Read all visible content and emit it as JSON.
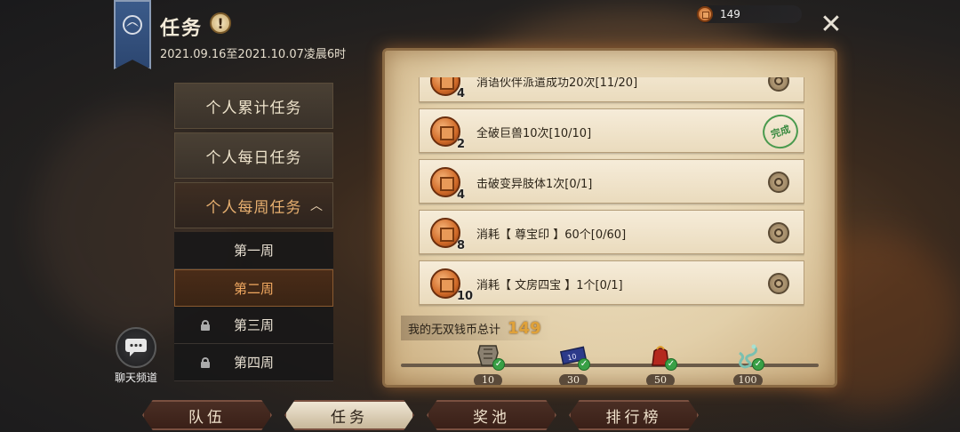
{
  "header": {
    "title": "任务",
    "alert_glyph": "!",
    "date_range": "2021.09.16至2021.10.07凌晨6时"
  },
  "currency": {
    "icon": "copper-coin-icon",
    "amount": "149"
  },
  "close_glyph": "✕",
  "menu": {
    "items": [
      {
        "label": "个人累计任务"
      },
      {
        "label": "个人每日任务"
      },
      {
        "label": "个人每周任务",
        "expanded": true
      }
    ],
    "weeks": [
      {
        "label": "第一周",
        "locked": false,
        "active": false
      },
      {
        "label": "第二周",
        "locked": false,
        "active": true
      },
      {
        "label": "第三周",
        "locked": true,
        "active": false
      },
      {
        "label": "第四周",
        "locked": true,
        "active": false
      }
    ]
  },
  "chat": {
    "label": "聊天频道"
  },
  "tasks": [
    {
      "name": "消语伙伴派遣成功20次[11/20]",
      "reward": "4",
      "completed": false
    },
    {
      "name": "全破巨兽10次[10/10]",
      "reward": "2",
      "completed": true,
      "stamp": "完成"
    },
    {
      "name": "击破变异肢体1次[0/1]",
      "reward": "4",
      "completed": false
    },
    {
      "name": "消耗【 尊宝印 】60个[0/60]",
      "reward": "8",
      "completed": false
    },
    {
      "name": "消耗【 文房四宝 】1个[0/1]",
      "reward": "10",
      "completed": false
    }
  ],
  "total": {
    "label": "我的无双钱币总计",
    "value": "149"
  },
  "milestones": [
    {
      "value": "10",
      "icon": "armor-icon",
      "claimed": true
    },
    {
      "value": "30",
      "icon": "ticket-icon",
      "claimed": true
    },
    {
      "value": "50",
      "icon": "gift-bag-icon",
      "claimed": true
    },
    {
      "value": "100",
      "icon": "dragon-icon",
      "claimed": true
    }
  ],
  "tabs": [
    {
      "label": "队伍",
      "active": false
    },
    {
      "label": "任务",
      "active": true
    },
    {
      "label": "奖池",
      "active": false
    },
    {
      "label": "排行榜",
      "active": false
    }
  ],
  "colors": {
    "accent_orange": "#f0a860",
    "complete_green": "#39a046",
    "gold_value": "#e0a23a"
  }
}
